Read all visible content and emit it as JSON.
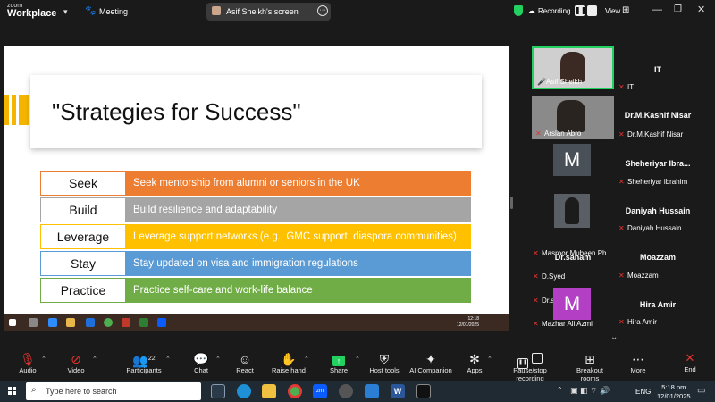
{
  "topbar": {
    "brand_small": "zoom",
    "brand_big": "Workplace",
    "meeting_label": "Meeting",
    "screen_label": "Asif Sheikh's screen",
    "recording_label": "Recording...",
    "view_label": "View"
  },
  "slide": {
    "title": "\"Strategies for Success\"",
    "rows": [
      {
        "key": "Seek",
        "text": "Seek mentorship from alumni or seniors in the UK",
        "color": "#ed7d31"
      },
      {
        "key": "Build",
        "text": "Build resilience and adaptability",
        "color": "#a5a5a5"
      },
      {
        "key": "Leverage",
        "text": "Leverage support networks (e.g., GMC support, diaspora communities)",
        "color": "#ffc000"
      },
      {
        "key": "Stay",
        "text": "Stay updated on visa and immigration regulations",
        "color": "#5b9bd5"
      },
      {
        "key": "Practice",
        "text": "Practice self-care and work-life balance",
        "color": "#70ad47"
      }
    ],
    "taskbar_time": "12:18",
    "taskbar_date": "12/01/2025"
  },
  "participants": [
    {
      "tile_name": "Asif Sheikh",
      "side_title": "IT",
      "side_label": "IT"
    },
    {
      "tile_name": "Arslan Abro",
      "side_title": "Dr.M.Kashif Nisar",
      "side_label": "Dr.M.Kashif Nisar"
    },
    {
      "tile_name": "Masroor Mubeen Ph...",
      "side_title": "Sheheriyar  Ibra...",
      "side_label": "Sheheriyar ibrahim",
      "avatar_letter": "M"
    },
    {
      "tile_name": "D.Syed",
      "side_title": "Daniyah Hussain",
      "side_label": "Daniyah Hussain"
    },
    {
      "tile_name": "Dr.sanam",
      "tile_title": "Dr.sanam",
      "side_title": "Moazzam",
      "side_label": "Moazzam"
    },
    {
      "tile_name": "Mazhar Ali Azmi",
      "side_title": "Hira Amir",
      "side_label": "Hira Amir",
      "avatar_letter": "M"
    }
  ],
  "controls": {
    "audio": "Audio",
    "video": "Video",
    "participants": "Participants",
    "participants_count": "22",
    "chat": "Chat",
    "react": "React",
    "raise_hand": "Raise hand",
    "share": "Share",
    "host_tools": "Host tools",
    "ai_companion": "AI Companion",
    "apps": "Apps",
    "pause_recording": "Pause/stop recording",
    "breakout_rooms": "Breakout rooms",
    "more": "More",
    "end": "End"
  },
  "windows": {
    "search_placeholder": "Type here to search",
    "lang": "ENG",
    "time": "5:18 pm",
    "date": "12/01/2025"
  },
  "colors": {
    "accent_green": "#23d160",
    "end_red": "#e0342f",
    "zoom_blue": "#0b5cff"
  }
}
